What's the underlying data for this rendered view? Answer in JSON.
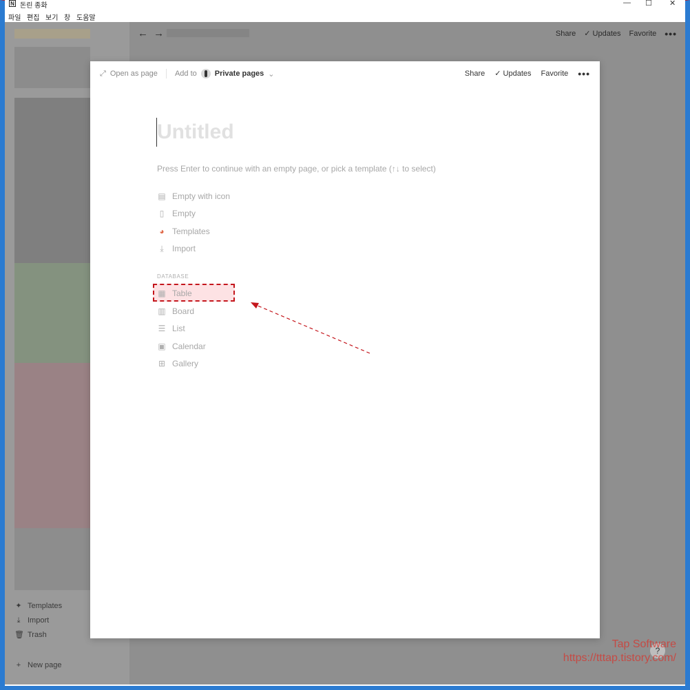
{
  "window": {
    "title": "돈린 종화",
    "minimize": "—",
    "maximize": "☐",
    "close": "✕"
  },
  "menu": [
    "파일",
    "편집",
    "보기",
    "창",
    "도움말"
  ],
  "topbar": {
    "share": "Share",
    "updates": "Updates",
    "favorite": "Favorite"
  },
  "sidebar": {
    "footer": [
      {
        "label": "Templates",
        "icon": "templates-icon"
      },
      {
        "label": "Import",
        "icon": "import-icon"
      },
      {
        "label": "Trash",
        "icon": "trash-icon"
      }
    ],
    "new_page": "New page"
  },
  "modal": {
    "open_as_page": "Open as page",
    "add_to": "Add to",
    "private_pages": "Private pages",
    "share": "Share",
    "updates": "Updates",
    "favorite": "Favorite",
    "title_placeholder": "Untitled",
    "hint": "Press Enter to continue with an empty page, or pick a template (↑↓ to select)",
    "options": [
      {
        "label": "Empty with icon",
        "icon": "document-lines-icon"
      },
      {
        "label": "Empty",
        "icon": "document-icon"
      },
      {
        "label": "Templates",
        "icon": "templates-icon"
      },
      {
        "label": "Import",
        "icon": "import-icon"
      }
    ],
    "database_label": "DATABASE",
    "database_options": [
      {
        "label": "Table",
        "icon": "table-icon"
      },
      {
        "label": "Board",
        "icon": "board-icon"
      },
      {
        "label": "List",
        "icon": "list-icon"
      },
      {
        "label": "Calendar",
        "icon": "calendar-icon"
      },
      {
        "label": "Gallery",
        "icon": "gallery-icon"
      }
    ]
  },
  "watermark": {
    "line1": "Tap Software",
    "line2": "https://tttap.tistory.com/"
  },
  "help": "?",
  "colors": {
    "annotation": "#c4161c",
    "highlight_fill": "#fde2e4"
  }
}
